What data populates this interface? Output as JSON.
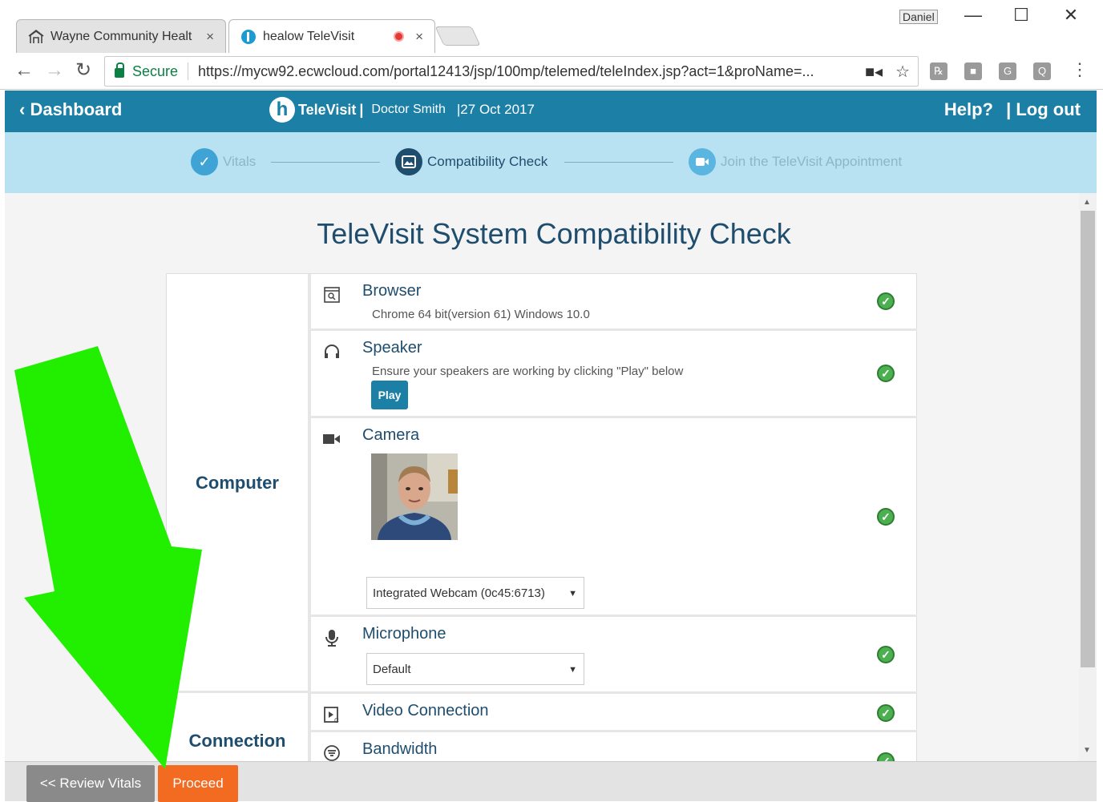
{
  "browser": {
    "profile_name": "Daniel",
    "tabs": [
      {
        "title": "Wayne Community Healt",
        "close": "×"
      },
      {
        "title": "healow TeleVisit",
        "close": "×"
      }
    ],
    "secure_label": "Secure",
    "url": "https://mycw92.ecwcloud.com/portal12413/jsp/100mp/telemed/teleIndex.jsp?act=1&proName=..."
  },
  "header": {
    "back_label": "Dashboard",
    "brand_name": "TeleVisit",
    "brand_sep": "|",
    "doctor": "Doctor Smith",
    "date": "|27 Oct 2017",
    "help": "Help?",
    "logout": "| Log out"
  },
  "steps": [
    {
      "label": "Vitals",
      "state": "done"
    },
    {
      "label": "Compatibility Check",
      "state": "current"
    },
    {
      "label": "Join the TeleVisit Appointment",
      "state": "pending"
    }
  ],
  "main": {
    "title": "TeleVisit System Compatibility Check",
    "groups": {
      "computer": "Computer",
      "connection": "Connection"
    },
    "checks": {
      "browser": {
        "title": "Browser",
        "detail": "Chrome 64 bit(version  61) Windows 10.0",
        "icon": "browser-icon"
      },
      "speaker": {
        "title": "Speaker",
        "detail": "Ensure your speakers are working by clicking \"Play\" below",
        "play_label": "Play",
        "icon": "headphones-icon"
      },
      "camera": {
        "title": "Camera",
        "device": "Integrated Webcam (0c45:6713)",
        "icon": "video-camera-icon"
      },
      "microphone": {
        "title": "Microphone",
        "device": "Default",
        "icon": "microphone-icon"
      },
      "video_connection": {
        "title": "Video Connection",
        "icon": "video-connection-icon"
      },
      "bandwidth": {
        "title": "Bandwidth",
        "icon": "bandwidth-icon"
      }
    }
  },
  "footer": {
    "review_label": "<< Review Vitals",
    "proceed_label": "Proceed"
  },
  "colors": {
    "header_bg": "#1b7fa6",
    "steps_bg": "#b8e1f1",
    "proceed_bg": "#f26b21",
    "check_green": "#4caf50",
    "annotation_arrow": "#22ee00"
  }
}
